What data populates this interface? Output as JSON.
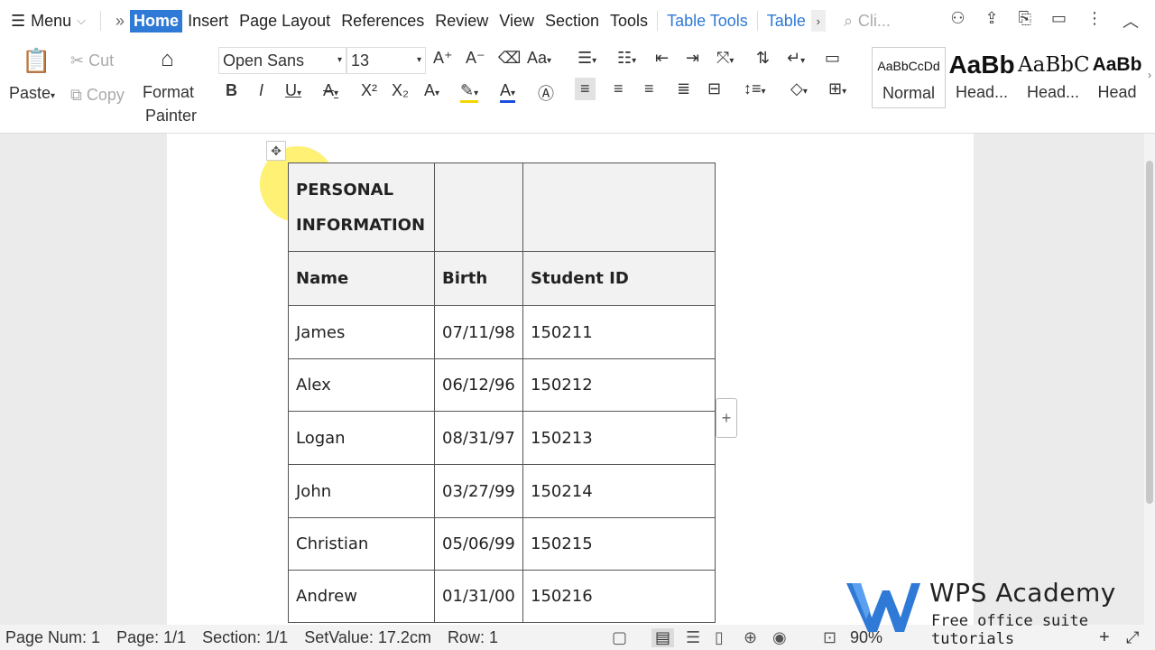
{
  "menubar": {
    "menu_label": "Menu",
    "more": "»",
    "tabs": [
      "Home",
      "Insert",
      "Page Layout",
      "References",
      "Review",
      "View",
      "Section",
      "Tools",
      "Table Tools",
      "Table"
    ],
    "active_tab": "Home",
    "search_placeholder": "Cli..."
  },
  "ribbon": {
    "paste": "Paste",
    "cut": "Cut",
    "copy": "Copy",
    "format_painter_1": "Format",
    "format_painter_2": "Painter",
    "font_name": "Open Sans",
    "font_size": "13",
    "styles": [
      {
        "preview": "AaBbCcDd",
        "name": "Normal"
      },
      {
        "preview": "AaBb",
        "name": "Head..."
      },
      {
        "preview": "AaBbC",
        "name": "Head..."
      },
      {
        "preview": "AaBb",
        "name": "Head"
      }
    ]
  },
  "table": {
    "title_line1": "PERSONAL",
    "title_line2": "INFORMATION",
    "headers": [
      "Name",
      "Birth",
      "Student ID"
    ],
    "rows": [
      [
        "James",
        "07/11/98",
        "150211"
      ],
      [
        "Alex",
        "06/12/96",
        "150212"
      ],
      [
        "Logan",
        "08/31/97",
        "150213"
      ],
      [
        "John",
        "03/27/99",
        "150214"
      ],
      [
        "Christian",
        "05/06/99",
        "150215"
      ],
      [
        "Andrew",
        "01/31/00",
        "150216"
      ]
    ]
  },
  "status": {
    "page_num": "Page Num: 1",
    "page": "Page: 1/1",
    "section": "Section: 1/1",
    "set_value": "SetValue: 17.2cm",
    "row": "Row: 1",
    "zoom": "90%"
  },
  "watermark": {
    "title": "WPS Academy",
    "subtitle": "Free office suite tutorials"
  },
  "colors": {
    "accent": "#2f7ad6",
    "highlight": "#ffe600"
  }
}
